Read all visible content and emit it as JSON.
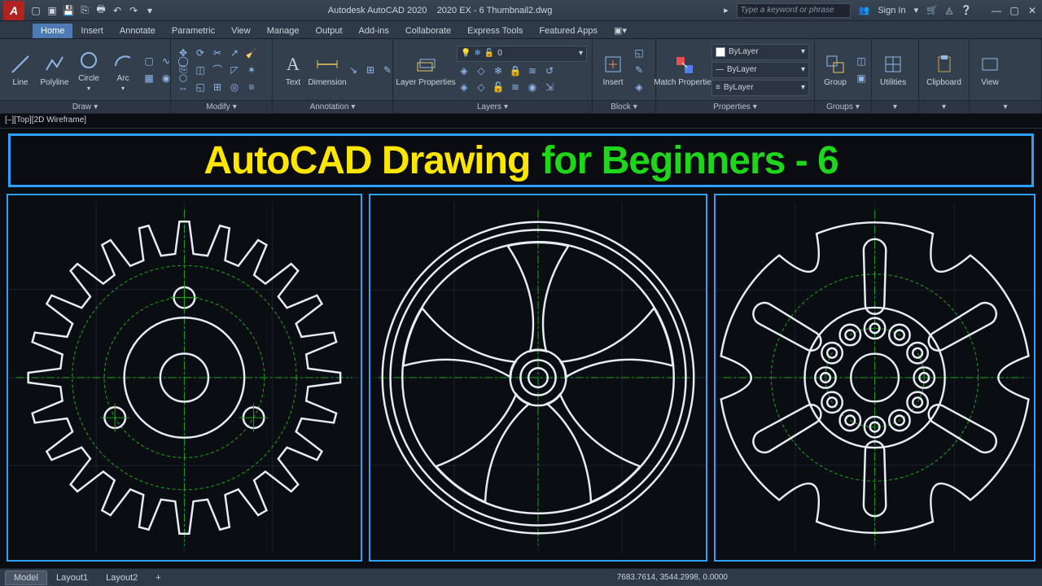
{
  "titlebar": {
    "app": "Autodesk AutoCAD 2020",
    "file": "2020 EX - 6 Thumbnail2.dwg",
    "search_placeholder": "Type a keyword or phrase",
    "signin": "Sign In"
  },
  "menu": {
    "tabs": [
      "Home",
      "Insert",
      "Annotate",
      "Parametric",
      "View",
      "Manage",
      "Output",
      "Add-ins",
      "Collaborate",
      "Express Tools",
      "Featured Apps"
    ],
    "active": 0
  },
  "ribbon": {
    "draw": {
      "title": "Draw",
      "tools": [
        "Line",
        "Polyline",
        "Circle",
        "Arc"
      ]
    },
    "modify": {
      "title": "Modify"
    },
    "annotation": {
      "title": "Annotation",
      "tools": [
        "Text",
        "Dimension"
      ]
    },
    "layers": {
      "title": "Layers",
      "tool": "Layer Properties",
      "current": "0"
    },
    "block": {
      "title": "Block",
      "tool": "Insert"
    },
    "properties": {
      "title": "Properties",
      "tool": "Match Properties",
      "rows": [
        "ByLayer",
        "ByLayer",
        "ByLayer"
      ]
    },
    "groups": {
      "title": "Groups",
      "tool": "Group"
    },
    "utilities": {
      "title": "Utilities"
    },
    "clipboard": {
      "title": "Clipboard"
    },
    "view": {
      "title": "View"
    }
  },
  "viewport": {
    "label": "[–][Top][2D Wireframe]"
  },
  "overlay": {
    "part1": "AutoCAD Drawing",
    "part2": "for Beginners - 6"
  },
  "bottom": {
    "tabs": [
      "Model",
      "Layout1",
      "Layout2"
    ],
    "active": 0,
    "coords": "7683.7614, 3544.2998, 0.0000"
  }
}
